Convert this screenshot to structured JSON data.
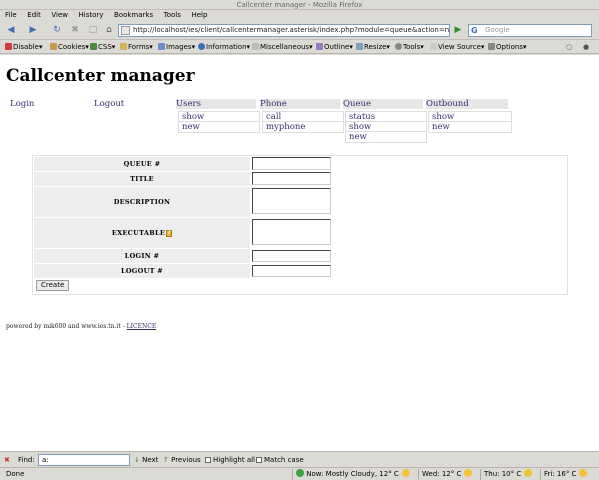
{
  "window": {
    "title": "Callcenter manager - Mozilla Firefox"
  },
  "menubar": [
    "File",
    "Edit",
    "View",
    "History",
    "Bookmarks",
    "Tools",
    "Help"
  ],
  "navbar": {
    "url": "http://localhost/ies/client/callcentermanager.asterisk/index.php?module=queue&action=new",
    "search_placeholder": "Google"
  },
  "devbar": [
    "Disable▾",
    "Cookies▾",
    "CSS▾",
    "Forms▾",
    "Images▾",
    "Information▾",
    "Miscellaneous▾",
    "Outline▾",
    "Resize▾",
    "Tools▾",
    "View Source▾",
    "Options▾"
  ],
  "page": {
    "heading": "Callcenter manager",
    "menu": [
      {
        "label": "Login",
        "items": []
      },
      {
        "label": "Logout",
        "items": []
      },
      {
        "label": "Users",
        "items": [
          "show",
          "new"
        ]
      },
      {
        "label": "Phone",
        "items": [
          "call",
          "myphone"
        ]
      },
      {
        "label": "Queue",
        "items": [
          "status",
          "show",
          "new"
        ]
      },
      {
        "label": "Outbound",
        "items": [
          "show",
          "new"
        ]
      }
    ],
    "form": {
      "fields": [
        "QUEUE #",
        "TITLE",
        "DESCRIPTION",
        "EXECUTABLE",
        "LOGIN #",
        "LOGOUT #"
      ],
      "help_icon": "?",
      "submit": "Create"
    },
    "footer": {
      "text": "powered by mik600 and www.ies.tn.it - ",
      "link": "LICENCE"
    }
  },
  "findbar": {
    "label": "Find:",
    "value": "a:",
    "next": "Next",
    "previous": "Previous",
    "highlight": "Highlight all",
    "match_case": "Match case"
  },
  "statusbar": {
    "status": "Done",
    "weather_now": "Now: Mostly Cloudy, 12° C",
    "wed": "Wed: 12° C",
    "thu": "Thu: 10° C",
    "fri": "Fri: 16° C"
  },
  "colors": {
    "link": "#3a2a6e",
    "label_bg": "#ededed",
    "menu_bg": "#e6e6e6"
  }
}
